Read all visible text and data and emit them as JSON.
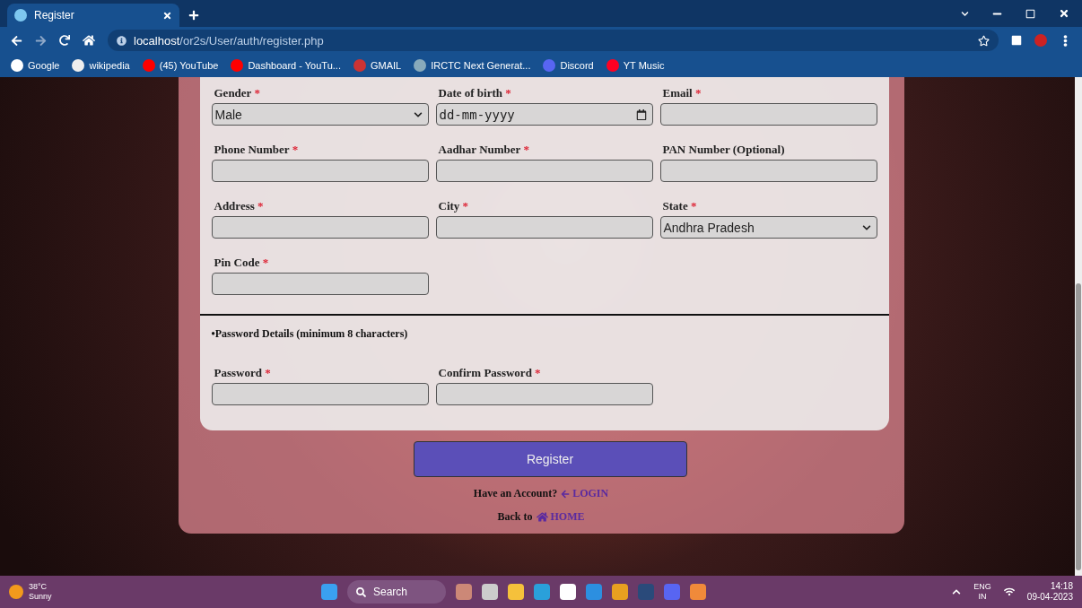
{
  "browser": {
    "tab_title": "Register",
    "url_host": "localhost",
    "url_path": "/or2s/User/auth/register.php",
    "bookmarks": [
      {
        "kind": "google",
        "label": "Google"
      },
      {
        "kind": "wiki",
        "label": "wikipedia"
      },
      {
        "kind": "youtube",
        "label": "(45) YouTube"
      },
      {
        "kind": "youtube",
        "label": "Dashboard - YouTu..."
      },
      {
        "kind": "gmail",
        "label": "GMAIL"
      },
      {
        "kind": "irctc",
        "label": "IRCTC Next Generat..."
      },
      {
        "kind": "discord",
        "label": "Discord"
      },
      {
        "kind": "ytmusic",
        "label": "YT Music"
      }
    ]
  },
  "form": {
    "fields": [
      {
        "label": "Gender",
        "mark": "*",
        "kind": "select",
        "value": "Male"
      },
      {
        "label": "Date of birth",
        "mark": "*",
        "kind": "date",
        "placeholder": "dd-mm-yyyy"
      },
      {
        "label": "Email",
        "mark": "*",
        "kind": "text"
      },
      {
        "label": "Phone Number",
        "mark": "*",
        "kind": "text"
      },
      {
        "label": "Aadhar Number",
        "mark": "*",
        "kind": "text"
      },
      {
        "label": "PAN Number (Optional)",
        "kind": "text"
      },
      {
        "label": "Address",
        "mark": "*",
        "kind": "text"
      },
      {
        "label": "City",
        "mark": "*",
        "kind": "text"
      },
      {
        "label": "State",
        "mark": "*",
        "kind": "select",
        "value": "Andhra Pradesh"
      },
      {
        "label": "Pin Code",
        "mark": "*",
        "kind": "text"
      }
    ],
    "password_section": "•Password Details (minimum 8 characters)",
    "password_fields": [
      {
        "label": "Password",
        "mark": "*",
        "kind": "text"
      },
      {
        "label": "Confirm Password",
        "mark": "*",
        "kind": "text"
      }
    ],
    "submit": "Register",
    "login_prompt": "Have an Account?",
    "login_link": "LOGIN",
    "home_prompt": "Back to",
    "home_link": "HOME"
  },
  "taskbar": {
    "temperature": "38°C",
    "weather": "Sunny",
    "search": "Search",
    "lang": "ENG",
    "region": "IN",
    "time": "14:18",
    "date": "09-04-2023"
  }
}
